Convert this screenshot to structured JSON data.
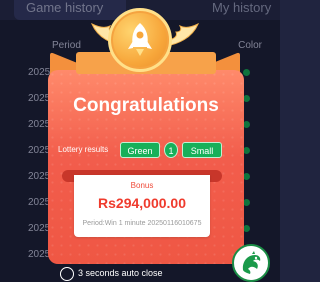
{
  "background": {
    "tabs": [
      "Game history",
      "My history"
    ],
    "header": {
      "period_label": "Period",
      "color_label": "Color"
    },
    "rows": [
      "2025",
      "2025",
      "2025",
      "2025",
      "2025",
      "2025",
      "2025",
      "2025"
    ]
  },
  "modal": {
    "title": "Congratulations",
    "lottery": {
      "label": "Lottery results",
      "color": "Green",
      "number": "1",
      "size": "Small"
    },
    "bonus": {
      "label": "Bonus",
      "amount": "Rs294,000.00",
      "period": "Period:Win 1 minute 20250116010675"
    },
    "autoclose": "3 seconds auto close"
  },
  "colors": {
    "accent": "#ef5744",
    "result_green": "#18b05a",
    "medal": "#f7a63a"
  },
  "icons": {
    "medal": "rocket-icon",
    "floating": "dragon-icon"
  }
}
